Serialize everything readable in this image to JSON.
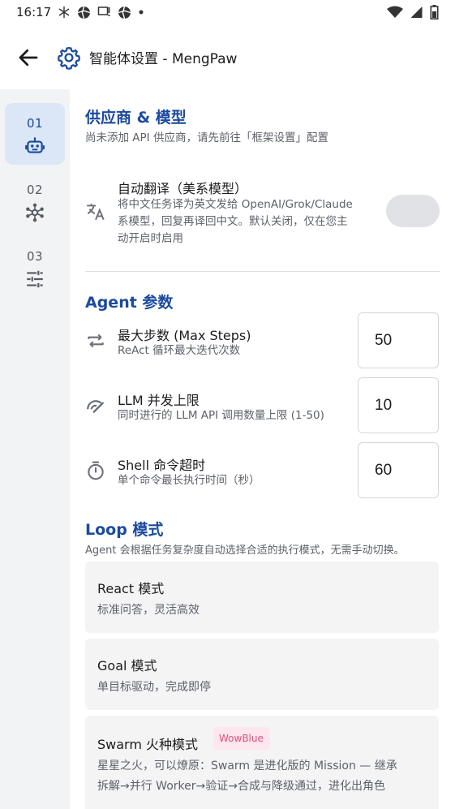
{
  "status_bar": {
    "time": "16:17",
    "notification_icons": [
      "snowflake-icon",
      "aperture-icon",
      "chat-alert-icon",
      "aperture-icon",
      "dot-icon"
    ],
    "right_icons": [
      "wifi-icon",
      "signal-icon",
      "battery-icon"
    ]
  },
  "app_bar": {
    "title": "智能体设置 - MengPaw"
  },
  "sidebar": {
    "items": [
      {
        "num": "01",
        "icon": "robot-icon",
        "active": true
      },
      {
        "num": "02",
        "icon": "hub-network-icon",
        "active": false
      },
      {
        "num": "03",
        "icon": "sliders-icon",
        "active": false
      }
    ]
  },
  "provider": {
    "title": "供应商 & 模型",
    "desc": "尚未添加 API 供应商，请先前往「框架设置」配置",
    "auto_translate": {
      "title": "自动翻译（美系模型）",
      "desc_lines": [
        "将中文任务译为英文发给 OpenAI/Grok/Claude",
        "系模型，回复再译回中文。默认关闭，仅在您主",
        "动开启时启用"
      ],
      "enabled": false
    }
  },
  "agent": {
    "title": "Agent 参数",
    "max_steps": {
      "title": "最大步数 (Max Steps)",
      "desc": "ReAct 循环最大迭代次数",
      "value": "50"
    },
    "llm_concurrency": {
      "title": "LLM 并发上限",
      "desc": "同时进行的 LLM API 调用数量上限 (1-50)",
      "value": "10"
    },
    "shell_timeout": {
      "title": "Shell 命令超时",
      "desc": "单个命令最长执行时间（秒）",
      "value": "60"
    }
  },
  "loop": {
    "title": "Loop 模式",
    "desc": "Agent 会根据任务复杂度自动选择合适的执行模式，无需手动切换。",
    "modes": [
      {
        "title": "React 模式",
        "desc": "标准问答，灵活高效"
      },
      {
        "title": "Goal 模式",
        "desc": "单目标驱动，完成即停"
      },
      {
        "title": "Swarm 火种模式",
        "badge": "WowBlue",
        "desc_lines": [
          "星星之火，可以燎原：Swarm 是进化版的 Mission — 继承",
          "拆解→并行 Worker→验证→合成与降级通过，进化出角色"
        ]
      }
    ]
  },
  "colors": {
    "accent": "#1b4aa0",
    "sidebar_bg": "#f2f3f5",
    "active_nav_bg": "#dbe6f7",
    "badge_text": "#e0507a",
    "badge_bg": "#fde6ee"
  }
}
